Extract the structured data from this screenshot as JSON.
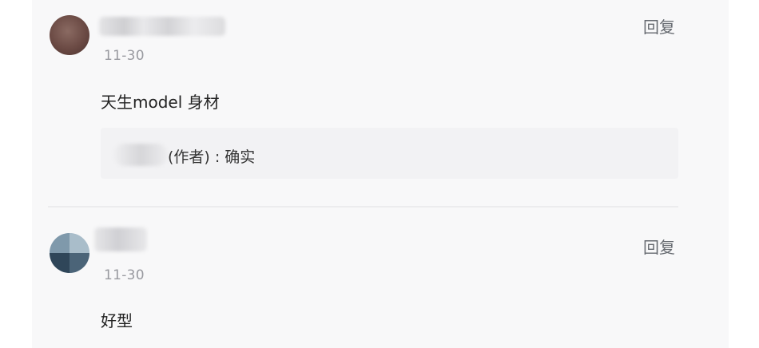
{
  "comments": [
    {
      "date": "11-30",
      "reply_label": "回复",
      "content": "天生model 身材",
      "sub_reply": {
        "text": "(作者) : 确实"
      }
    },
    {
      "date": "11-30",
      "reply_label": "回复",
      "content": "好型"
    }
  ]
}
